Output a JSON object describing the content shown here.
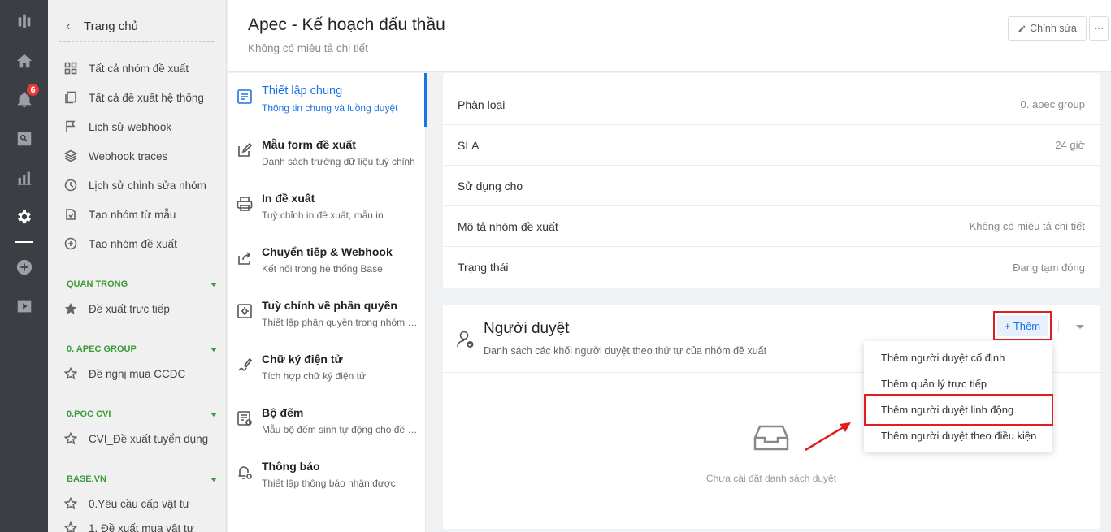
{
  "rail": {
    "notification_count": "6"
  },
  "sidebar": {
    "header_title": "Trang chủ",
    "items": [
      {
        "label": "Tất cả nhóm đề xuất"
      },
      {
        "label": "Tất cả đề xuất hệ thống"
      },
      {
        "label": "Lịch sử webhook"
      },
      {
        "label": "Webhook traces"
      },
      {
        "label": "Lịch sử chỉnh sửa nhóm"
      },
      {
        "label": "Tạo nhóm từ mẫu"
      },
      {
        "label": "Tạo nhóm đề xuất"
      }
    ],
    "sections": [
      {
        "title": "QUAN TRỌNG",
        "item": "Đề xuất trực tiếp"
      },
      {
        "title": "0. APEC GROUP",
        "item": "Đề nghị mua CCDC"
      },
      {
        "title": "0.POC CVI",
        "item": "CVI_Đề xuất tuyển dụng"
      },
      {
        "title": "BASE.VN",
        "item": "0.Yêu cầu cấp vật tư",
        "item2": "1. Đề xuất mua vật tư"
      }
    ]
  },
  "header": {
    "title": "Apec - Kế hoạch đấu thầu",
    "subtitle": "Không có miêu tả chi tiết",
    "edit_label": "Chỉnh sửa",
    "more_label": "···"
  },
  "menu": {
    "items": [
      {
        "title": "Thiết lập chung",
        "desc": "Thông tin chung và luồng duyệt"
      },
      {
        "title": "Mẫu form đề xuất",
        "desc": "Danh sách trường dữ liệu tuỳ chỉnh"
      },
      {
        "title": "In đề xuất",
        "desc": "Tuỳ chỉnh in đề xuất, mẫu in"
      },
      {
        "title": "Chuyển tiếp & Webhook",
        "desc": "Kết nối trong hệ thống Base"
      },
      {
        "title": "Tuỳ chỉnh về phân quyền",
        "desc": "Thiết lập phân quyền trong nhóm đề xuất"
      },
      {
        "title": "Chữ ký điện tử",
        "desc": "Tích hợp chữ ký điện tử"
      },
      {
        "title": "Bộ đếm",
        "desc": "Mẫu bộ đếm sinh tự động cho đề xuất"
      },
      {
        "title": "Thông báo",
        "desc": "Thiết lập thông báo nhận được"
      }
    ]
  },
  "details": {
    "rows": [
      {
        "label": "Phân loại",
        "value": "0. apec group"
      },
      {
        "label": "SLA",
        "value": "24 giờ"
      },
      {
        "label": "Sử dụng cho",
        "value": ""
      },
      {
        "label": "Mô tả nhóm đề xuất",
        "value": "Không có miêu tả chi tiết"
      },
      {
        "label": "Trạng thái",
        "value": "Đang tạm đóng"
      }
    ]
  },
  "approvers": {
    "title": "Người duyệt",
    "desc": "Danh sách các khối người duyệt theo thứ tự của nhóm đề xuất",
    "add_label": "+ Thêm",
    "empty_text": "Chưa cài đặt danh sách duyệt"
  },
  "dropdown": {
    "items": [
      {
        "label": "Thêm người duyệt cố định"
      },
      {
        "label": "Thêm quản lý trực tiếp"
      },
      {
        "label": "Thêm người duyệt linh động"
      },
      {
        "label": "Thêm người duyệt theo điều kiện"
      }
    ]
  },
  "colors": {
    "accent": "#1a73e8",
    "highlight": "#e11d1d",
    "section": "#3b9a36",
    "rail": "#3b3f44"
  }
}
